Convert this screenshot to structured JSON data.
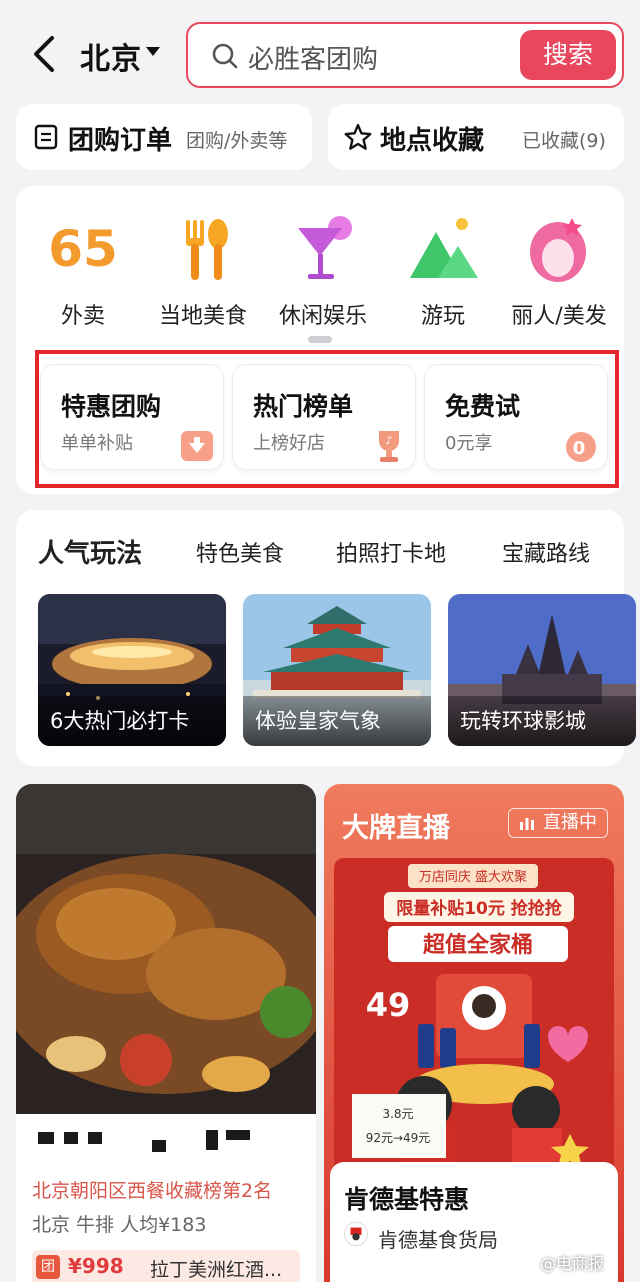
{
  "header": {
    "city": "北京",
    "search_placeholder": "必胜客团购",
    "search_button": "搜索"
  },
  "quick": {
    "orders": {
      "label": "团购订单",
      "sub": "团购/外卖等"
    },
    "favorites": {
      "label": "地点收藏",
      "sub": "已收藏(9)"
    }
  },
  "categories": [
    {
      "label": "外卖",
      "icon": "takeout-65-icon"
    },
    {
      "label": "当地美食",
      "icon": "fork-spoon-icon"
    },
    {
      "label": "休闲娱乐",
      "icon": "cocktail-icon"
    },
    {
      "label": "游玩",
      "icon": "mountain-icon"
    },
    {
      "label": "丽人/美发",
      "icon": "beauty-icon"
    }
  ],
  "promos": [
    {
      "title": "特惠团购",
      "sub": "单单补贴",
      "icon": "discount-tag-icon"
    },
    {
      "title": "热门榜单",
      "sub": "上榜好店",
      "icon": "trophy-icon"
    },
    {
      "title": "免费试",
      "sub": "0元享",
      "icon": "zero-yuan-icon"
    }
  ],
  "popular": {
    "tabs": [
      "人气玩法",
      "特色美食",
      "拍照打卡地",
      "宝藏路线"
    ],
    "tiles": [
      {
        "caption": "6大热门必打卡"
      },
      {
        "caption": "体验皇家气象"
      },
      {
        "caption": "玩转环球影城"
      }
    ]
  },
  "feed_left": {
    "rank": "北京朝阳区西餐收藏榜第2名",
    "meta": "北京 牛排 人均¥183",
    "deal_tag": "团",
    "deal_price": "¥998",
    "deal_name": "拉丁美洲红酒..."
  },
  "feed_right": {
    "title": "大牌直播",
    "badge": "直播中",
    "poster_text": [
      "万店同庆 盛大欢聚",
      "限量补贴10元 抢抢抢",
      "超值全家桶",
      "49"
    ],
    "brand": "肯德基特惠",
    "shop": "肯德基食货局"
  },
  "watermark": "@电商报",
  "colors": {
    "accent": "#e8475e",
    "highlight": "#e4262b",
    "rank_red": "#d9564b"
  }
}
